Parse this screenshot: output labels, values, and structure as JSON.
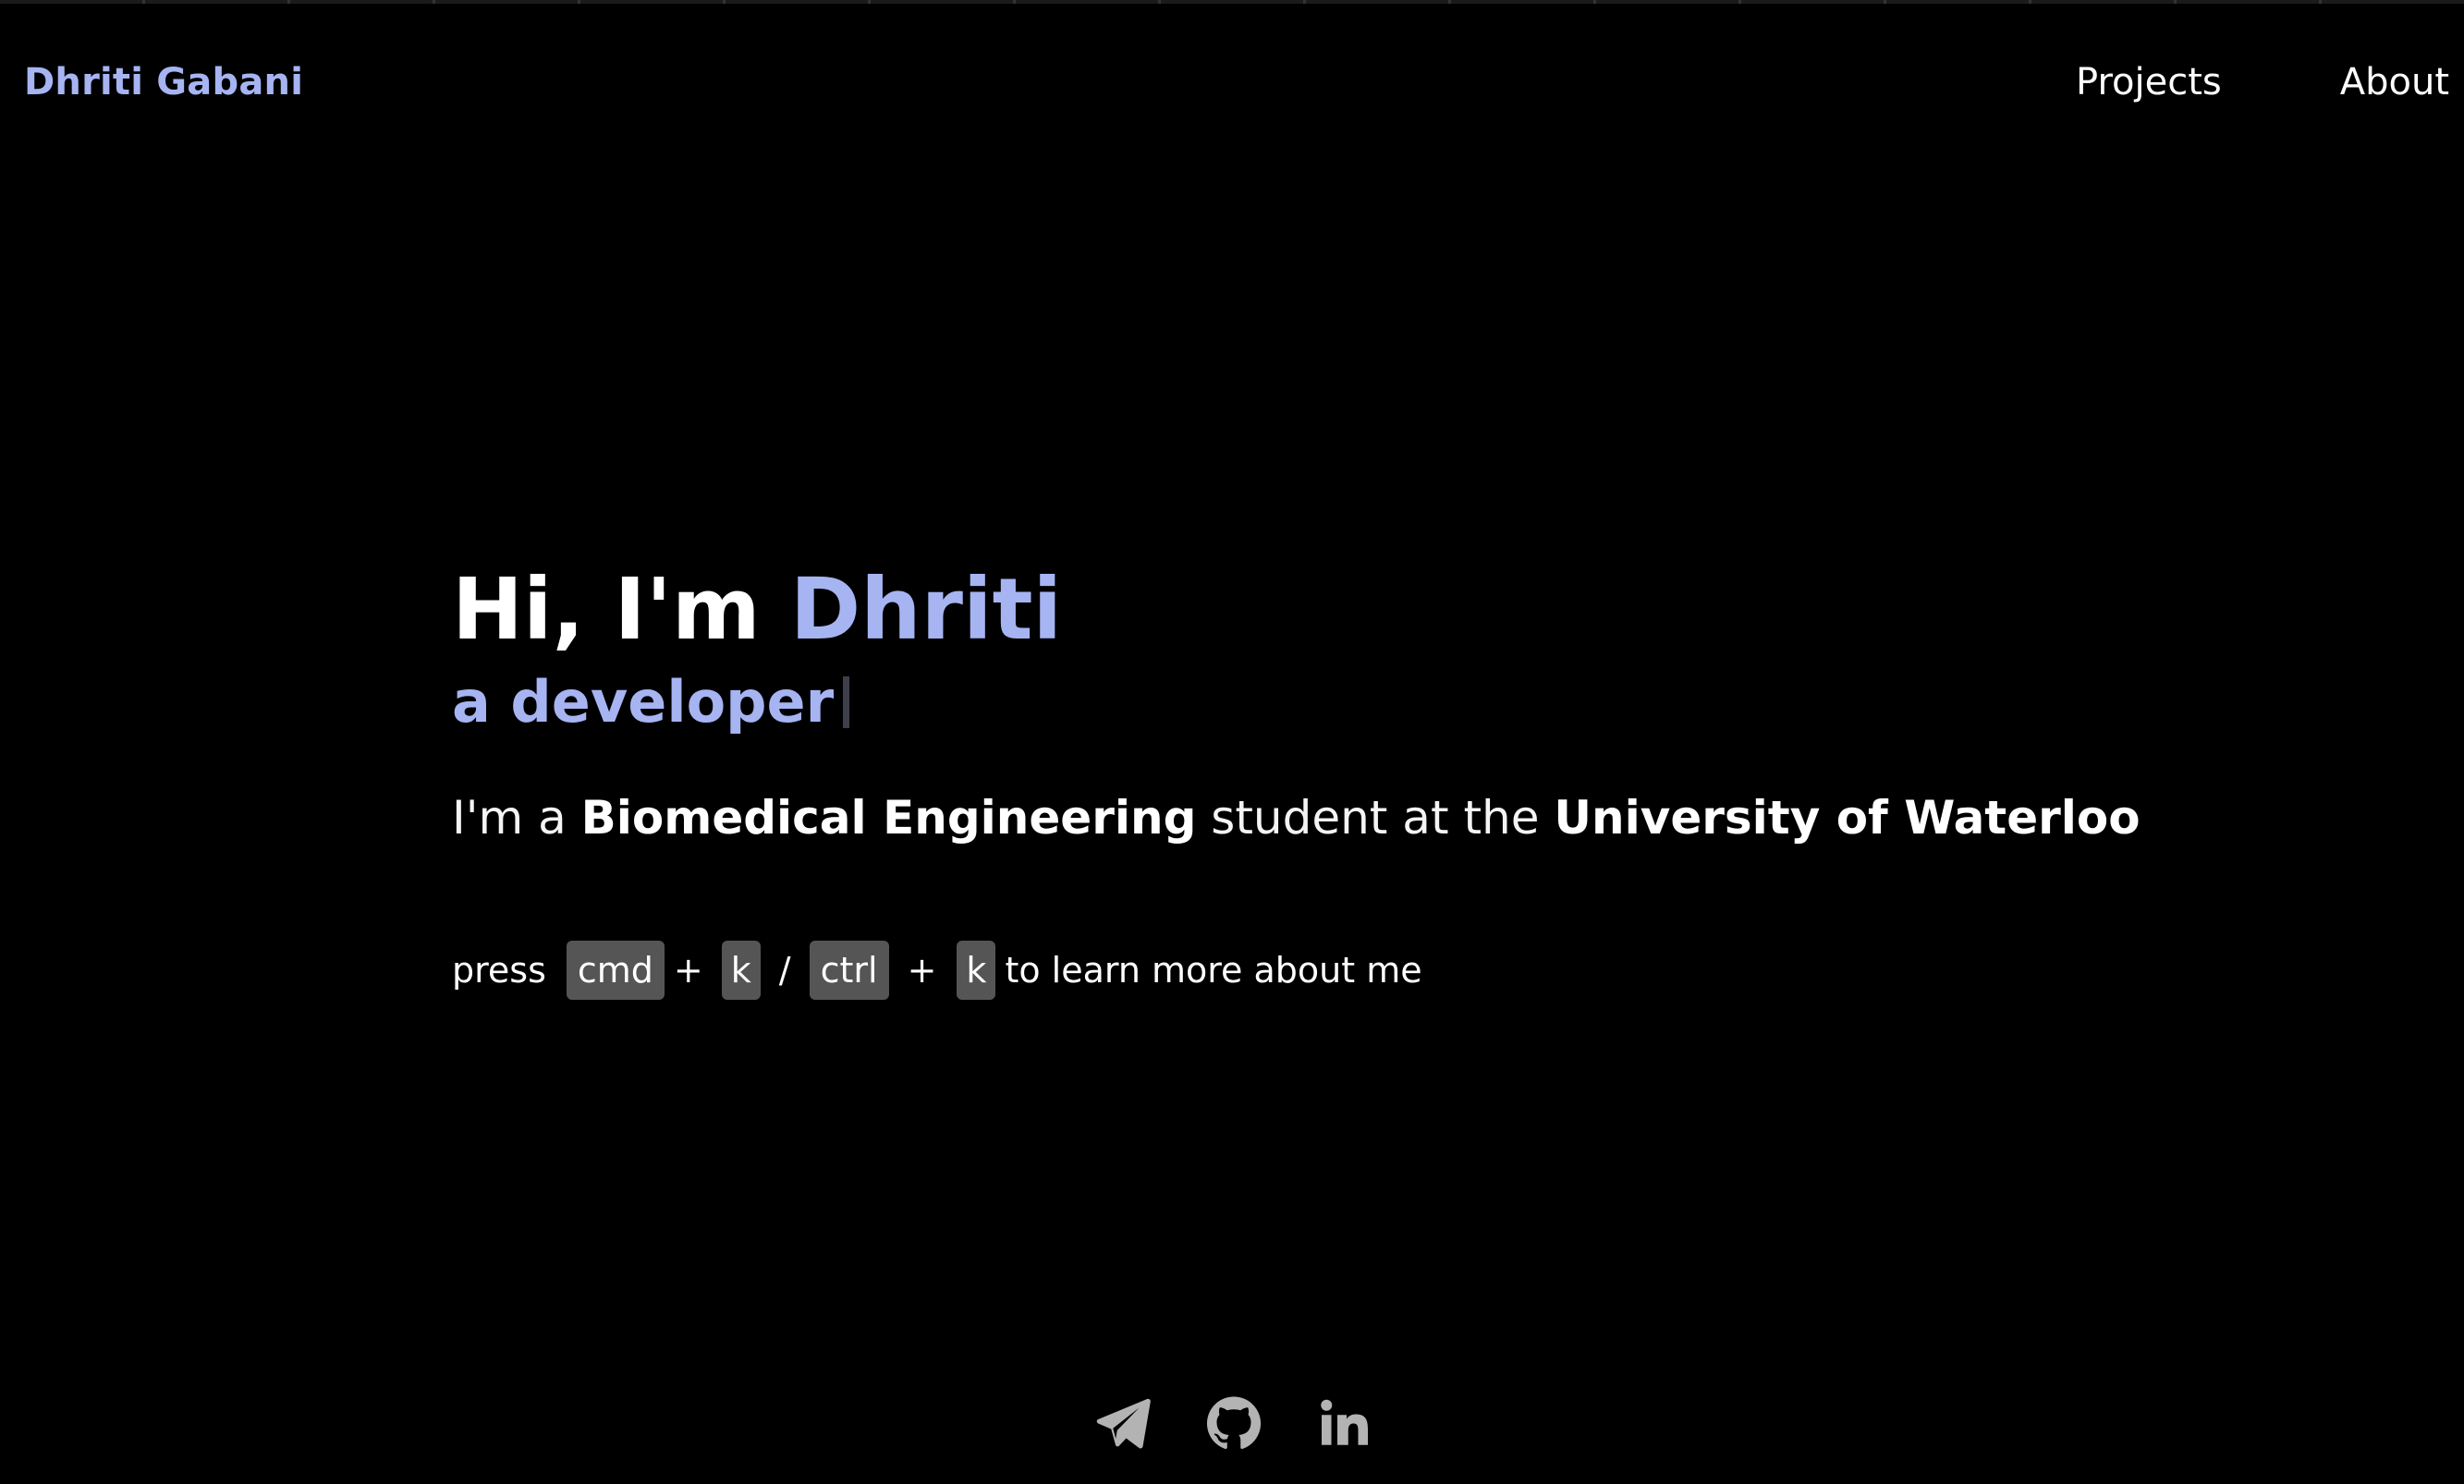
{
  "header": {
    "brand": "Dhriti Gabani",
    "nav": [
      {
        "label": "Projects"
      },
      {
        "label": "About"
      }
    ]
  },
  "hero": {
    "greeting": "Hi, I'm ",
    "name": "Dhriti",
    "typed_text": "a developer",
    "intro": {
      "prefix": "I'm a ",
      "field": "Biomedical Engineering",
      "middle": " student at the ",
      "school": "University of Waterloo"
    },
    "shortcut": {
      "press": "press",
      "key_cmd": "cmd",
      "plus": "+",
      "key_k": "k",
      "slash": "/",
      "key_ctrl": "ctrl",
      "suffix": "to learn more about me"
    }
  },
  "social": [
    {
      "icon": "paper-plane-icon"
    },
    {
      "icon": "github-icon"
    },
    {
      "icon": "linkedin-icon"
    }
  ],
  "colors": {
    "background": "#000000",
    "accent": "#a6b4f2",
    "key_background": "#555555",
    "icon_gray": "#b3b3b3"
  }
}
